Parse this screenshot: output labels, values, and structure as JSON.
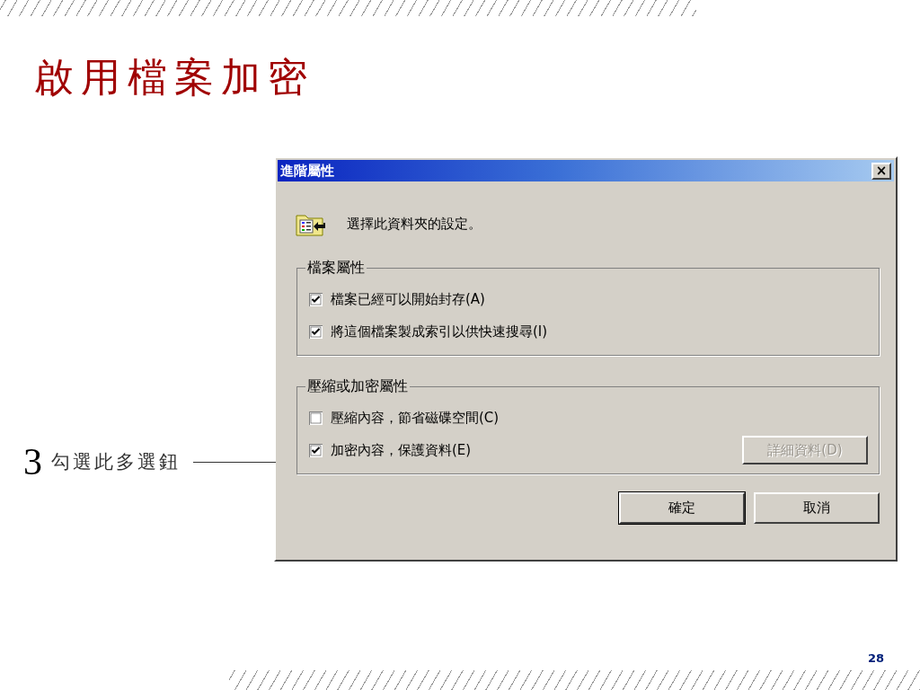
{
  "slide": {
    "title": "啟用檔案加密",
    "page_number": "28"
  },
  "callout": {
    "step": "3",
    "text": "勾選此多選鈕"
  },
  "dialog": {
    "title": "進階屬性",
    "close": "×",
    "description": "選擇此資料夾的設定。",
    "groups": [
      {
        "label": "檔案屬性",
        "options": [
          {
            "label": "檔案已經可以開始封存(A)",
            "checked": true
          },
          {
            "label": "將這個檔案製成索引以供快速搜尋(I)",
            "checked": true
          }
        ]
      },
      {
        "label": "壓縮或加密屬性",
        "options": [
          {
            "label": "壓縮內容，節省磁碟空間(C)",
            "checked": false
          },
          {
            "label": "加密內容，保護資料(E)",
            "checked": true,
            "button": {
              "label": "詳細資料(D)",
              "disabled": true
            }
          }
        ]
      }
    ],
    "buttons": [
      {
        "label": "確定",
        "default": true
      },
      {
        "label": "取消",
        "default": false
      }
    ]
  }
}
